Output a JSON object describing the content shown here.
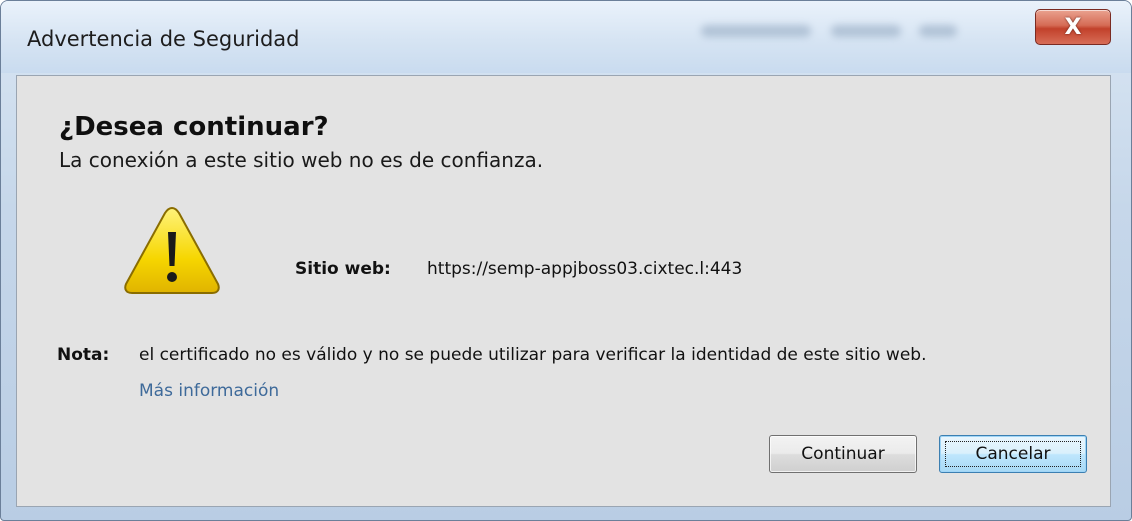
{
  "window": {
    "title": "Advertencia de Seguridad",
    "close_label": "X"
  },
  "dialog": {
    "heading": "¿Desea continuar?",
    "subheading": "La conexión a este sitio web no es de confianza.",
    "icon": "warning-triangle-icon",
    "site_label": "Sitio web:",
    "site_value": "https://semp-appjboss03.cixtec.l:443",
    "note_label": "Nota:",
    "note_text": "el certificado no es válido y no se puede utilizar para verificar la identidad de este sitio web.",
    "more_info": "Más información"
  },
  "buttons": {
    "continue_label": "Continuar",
    "cancel_label": "Cancelar"
  },
  "colors": {
    "close_button": "#c2412b",
    "link": "#3e6a9a",
    "content_bg": "#e3e3e3",
    "focused_button_border": "#3c7fb1",
    "warning_yellow": "#f6d600"
  }
}
